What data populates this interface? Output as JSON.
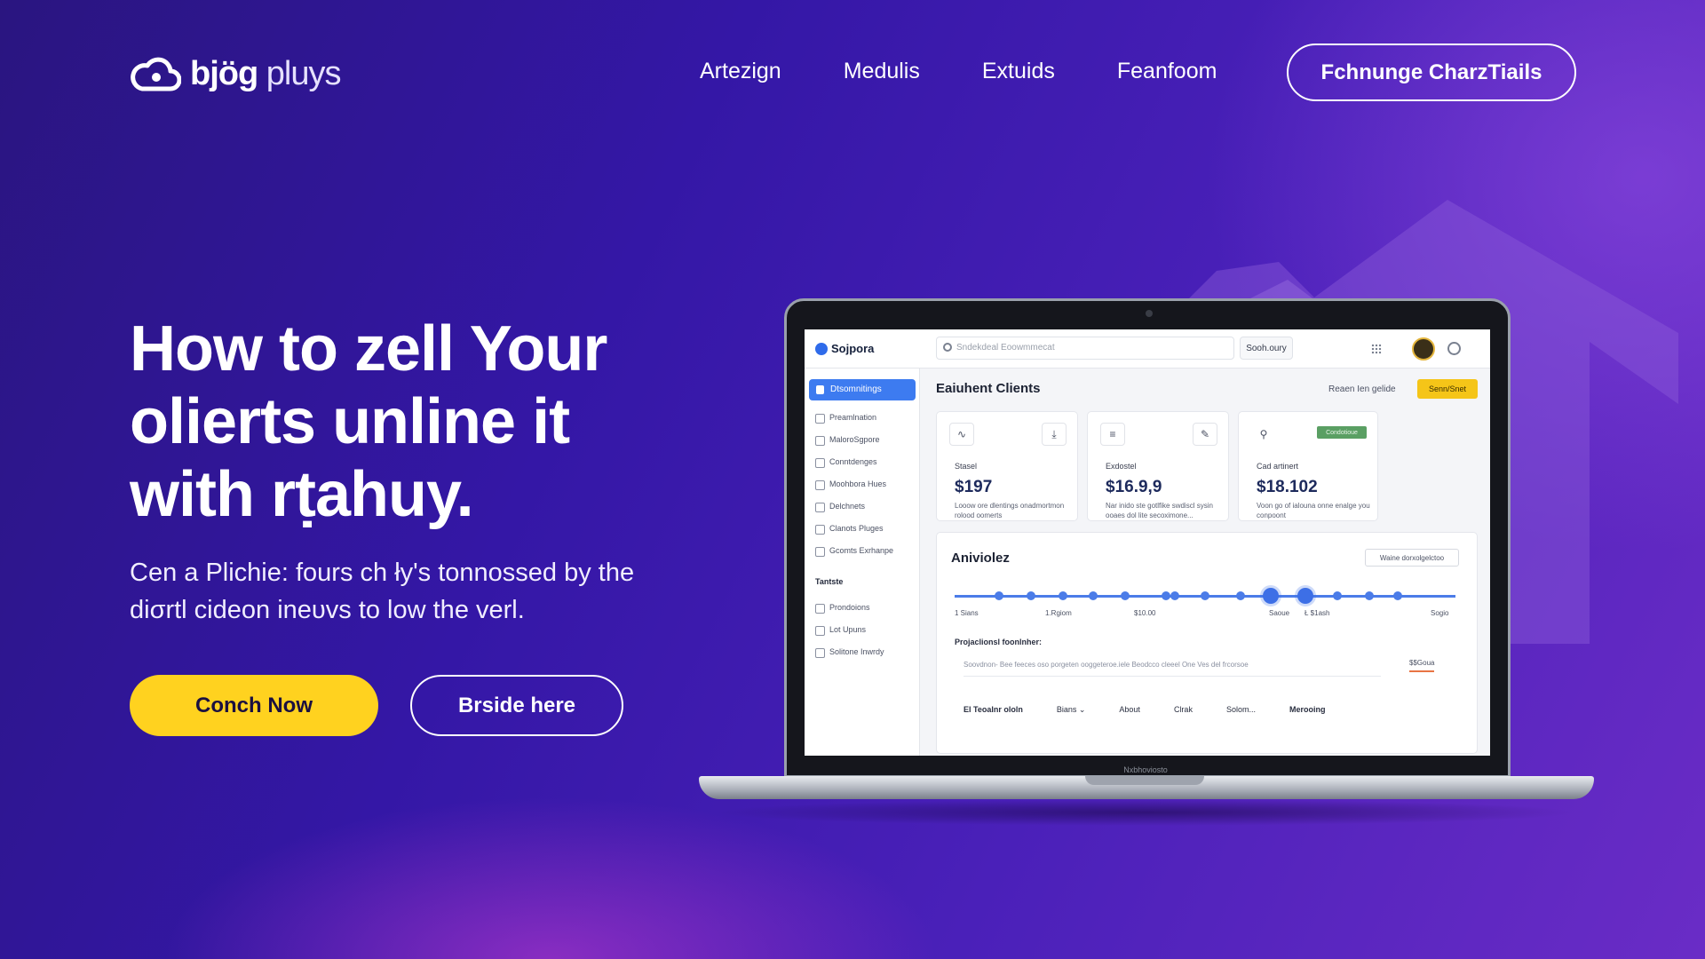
{
  "brand": {
    "name_bold": "bjög",
    "name_light": "pluуѕ"
  },
  "nav": {
    "links": [
      "Artezign",
      "Medulis",
      "Extuids",
      "Feanfoom"
    ],
    "cta": "Fchnunge CharzTiails"
  },
  "hero": {
    "title": "How to zell Your olierts unline it with rṭahuy.",
    "subtitle": "Cen a Plichie: fours ch ły's tonnossed by the diσrtl cideon ineυvs to low the verl.",
    "primary_button": "Conch Now",
    "secondary_button": "Brside here"
  },
  "laptop": {
    "base_label": "Nxbhoviosto",
    "app": {
      "brand": "Sojpora",
      "search_placeholder": "Sndekdeal Eoowmmecat",
      "search_button": "Sooh.oury",
      "sidebar": {
        "active": "Dtsomnitings",
        "items": [
          "Preamlnation",
          "MaloroSgpore",
          "Conntdenges",
          "Moohbora Hues",
          "Delchnets",
          "Clanots Pluges",
          "Gcomts Exrhanpe"
        ],
        "section": "Tantste",
        "section_items": [
          "Prondoions",
          "Lot Upuns",
          "Solitone Inwrdy"
        ]
      },
      "main_title": "Eaiuhent Clients",
      "header_link": "Reaen Ien gelide",
      "header_badge": "Senn/Snet",
      "cards": [
        {
          "label": "Stasel",
          "value": "$197",
          "desc": "Looow ore dlentings onadmortmon rolood oomerts",
          "icon": "activity-icon",
          "icon2": "download-icon"
        },
        {
          "label": "Exdostel",
          "value": "$16.9,9",
          "desc": "Nar inido ste gotlfike swdiscl sysin ooaes dol lite secoximone...",
          "icon": "menu-icon",
          "icon2": "edit-icon"
        },
        {
          "label": "Cad artinert",
          "value": "$18.102",
          "desc": "Voon go of ialouna onne enalge you conpoont",
          "icon": "user-icon",
          "tag": "Condotioue"
        }
      ],
      "panel": {
        "title": "Aniviolez",
        "button": "Waine dorxolgelctoo",
        "ticks": [
          "1 Sians",
          "1.Rgiom",
          "$10.00",
          "Saoue",
          "Ł $1ash",
          "Sogio"
        ],
        "subtitle": "Projaclionsl foonlnher:",
        "row_text": "Soovdnon- Bee feeces   oso porgeten ooggeteroe.iele    Beodcco   cleeel   One Ves del frcorsoe",
        "row_value": "$$Goua",
        "footer": [
          "El Teoalnr ololn",
          "Bians ⌄",
          "About",
          "Clrak",
          "Solom...",
          "Merooing"
        ]
      }
    }
  },
  "colors": {
    "accent_yellow": "#ffd21f",
    "screen_blue": "#3d7bf0",
    "bg_purple": "#3417a6"
  }
}
